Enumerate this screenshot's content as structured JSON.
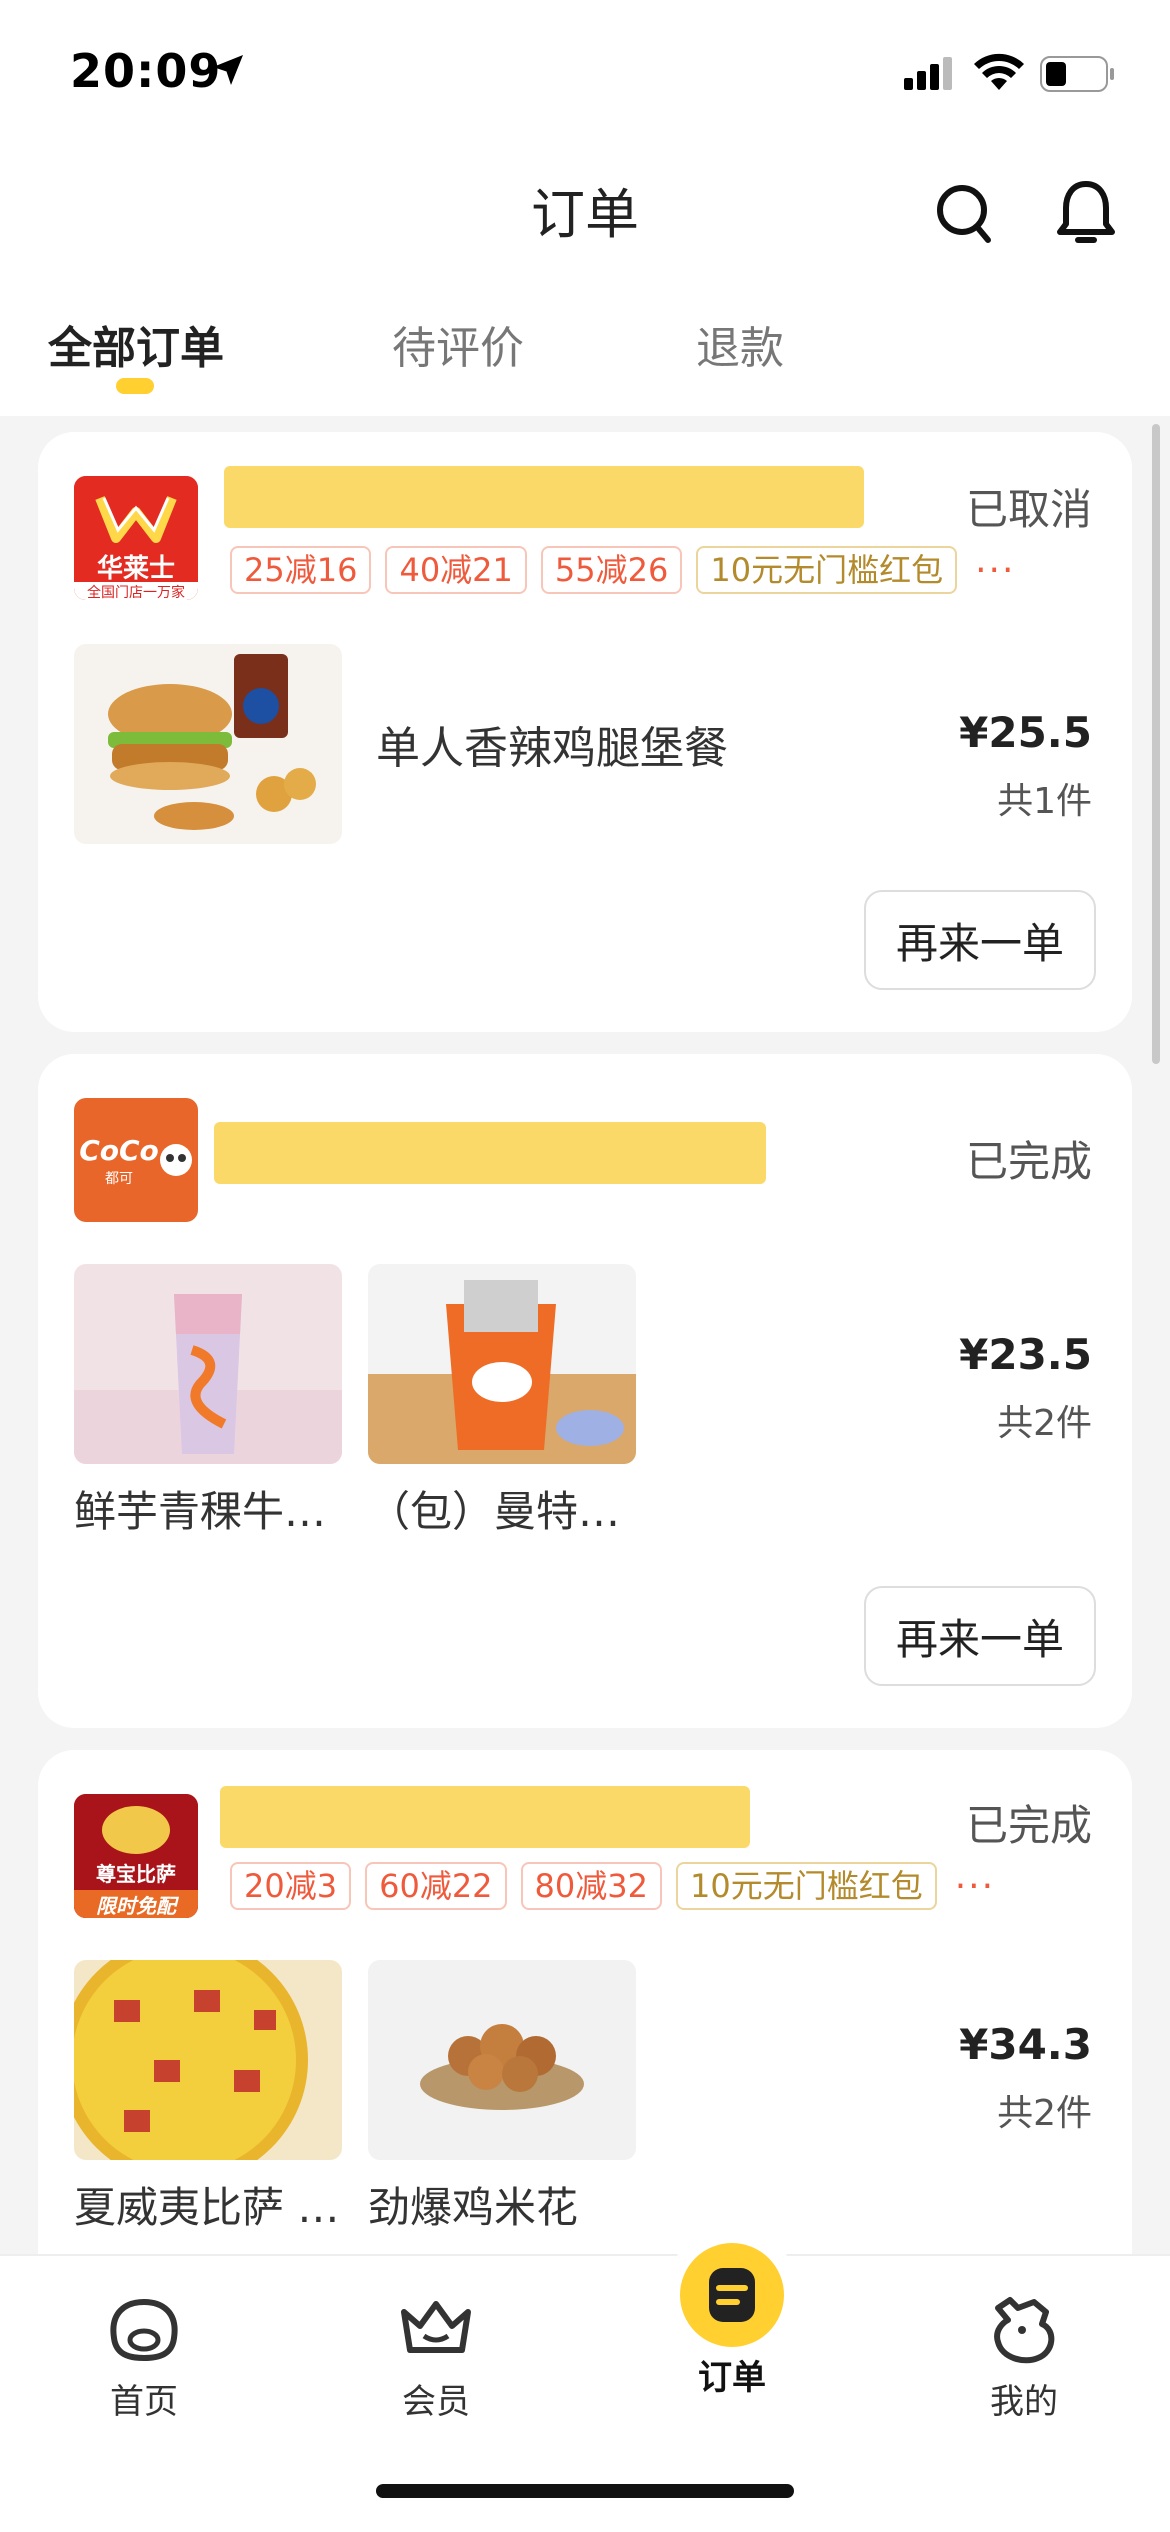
{
  "status_bar": {
    "time": "20:09"
  },
  "nav": {
    "title": "订单"
  },
  "tabs": [
    {
      "label": "全部订单",
      "active": true
    },
    {
      "label": "待评价",
      "active": false
    },
    {
      "label": "退款",
      "active": false
    }
  ],
  "orders": [
    {
      "logo_text": "华莱士",
      "logo_sub": "全国门店一万家",
      "status": "已取消",
      "promos": [
        "25减16",
        "40减21",
        "55减26"
      ],
      "promo_gold": "10元无门槛红包",
      "promo_more": "···",
      "item_name": "单人香辣鸡腿堡餐",
      "price": "¥25.5",
      "count": "共1件",
      "action": "再来一单"
    },
    {
      "logo_text": "CoCo",
      "logo_sub": "都可",
      "status": "已完成",
      "items": [
        "鲜芋青稞牛…",
        "（包）曼特…"
      ],
      "price": "¥23.5",
      "count": "共2件",
      "action": "再来一单"
    },
    {
      "logo_text": "尊宝比萨",
      "logo_sub": "限时免配",
      "status": "已完成",
      "promos": [
        "20减3",
        "60减22",
        "80减32"
      ],
      "promo_gold": "10元无门槛红包",
      "promo_more": "···",
      "items": [
        "夏威夷比萨 …",
        "劲爆鸡米花"
      ],
      "price": "¥34.3",
      "count": "共2件"
    }
  ],
  "tabbar": [
    {
      "label": "首页",
      "icon": "home-icon",
      "active": false
    },
    {
      "label": "会员",
      "icon": "member-crown-icon",
      "active": false
    },
    {
      "label": "订单",
      "icon": "order-icon",
      "active": true
    },
    {
      "label": "我的",
      "icon": "profile-icon",
      "active": false
    }
  ],
  "colors": {
    "accent": "#ffd02f",
    "promo": "#ef5a3c",
    "mask": "#fbd969"
  }
}
